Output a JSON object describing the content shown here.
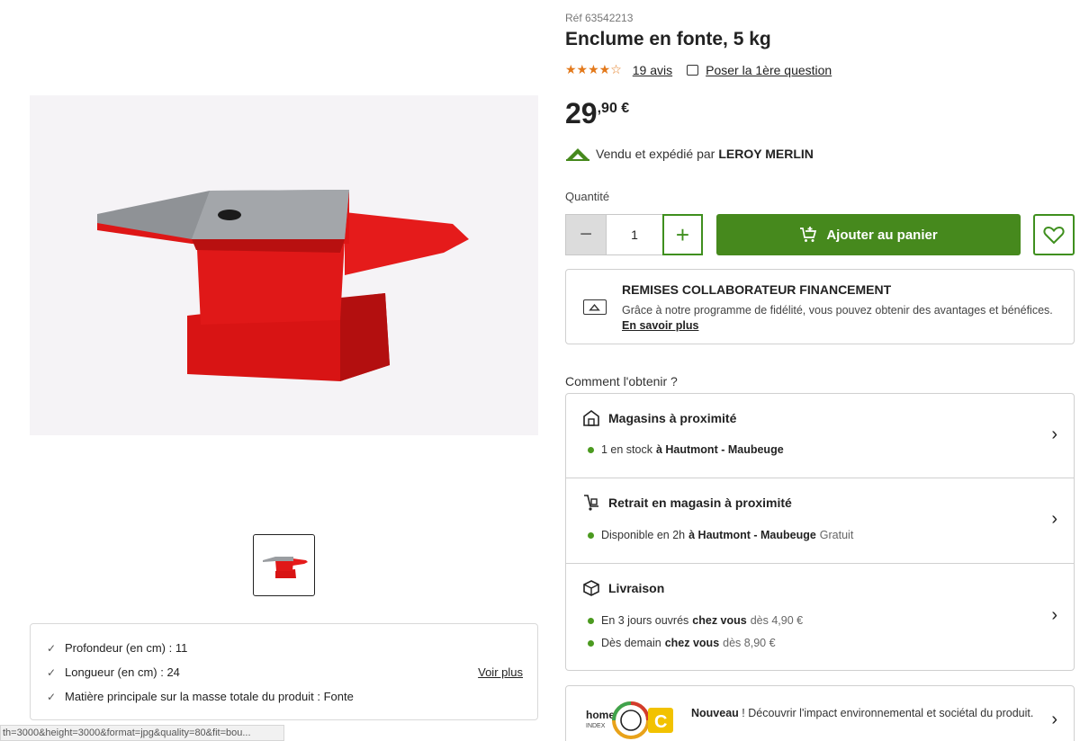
{
  "product": {
    "ref": "Réf 63542213",
    "title": "Enclume en fonte, 5 kg",
    "rating_stars": "★★★★☆",
    "reviews_link": "19 avis",
    "question_link": "Poser la 1ère question",
    "price_int": "29",
    "price_dec": ",90 €",
    "seller_prefix": "Vendu et expédié par",
    "seller_name": "LEROY MERLIN"
  },
  "purchase": {
    "quantity_label": "Quantité",
    "quantity_value": "1",
    "minus": "−",
    "plus": "+",
    "add_to_cart": "Ajouter au panier"
  },
  "promo": {
    "title": "REMISES COLLABORATEUR FINANCEMENT",
    "text": "Grâce à notre programme de fidélité, vous pouvez obtenir des avantages et bénéfices.",
    "link": "En savoir plus"
  },
  "obtain": {
    "label": "Comment l'obtenir ?",
    "stores": {
      "title": "Magasins à proximité",
      "line_pre": "1 en stock",
      "line_bold": "à Hautmont - Maubeuge"
    },
    "pickup": {
      "title": "Retrait en magasin à proximité",
      "line_pre": "Disponible en 2h",
      "line_bold": "à Hautmont - Maubeuge",
      "line_post": "Gratuit"
    },
    "delivery": {
      "title": "Livraison",
      "line1_pre": "En 3 jours ouvrés",
      "line1_bold": "chez vous",
      "line1_post": "dès 4,90 €",
      "line2_pre": "Dès demain",
      "line2_bold": "chez vous",
      "line2_post": "dès 8,90 €"
    },
    "chevron": "›"
  },
  "envo": {
    "logo_text": "home",
    "logo_sub": "INDEX",
    "grade": "C",
    "bold": "Nouveau",
    "text": " ! Découvrir l'impact environnemental et sociétal du produit."
  },
  "specs": {
    "check": "✓",
    "items": [
      "Profondeur (en cm) : 11",
      "Longueur (en cm) : 24",
      "Matière principale sur la masse totale du produit : Fonte"
    ],
    "more": "Voir plus"
  },
  "status_bar": "th=3000&height=3000&format=jpg&quality=80&fit=bou...",
  "colors": {
    "accent_green": "#46891d",
    "star_orange": "#e3791b",
    "anvil_red": "#e11a1a"
  }
}
